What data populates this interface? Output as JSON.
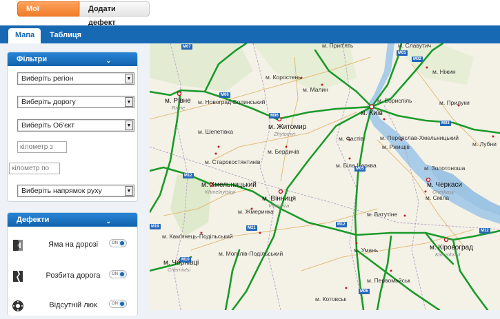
{
  "top": {
    "my_defects": "Мої дефекти",
    "add_defect": "Додати дефект"
  },
  "tabs": {
    "map": "Мапа",
    "table": "Таблиця"
  },
  "filters": {
    "title": "Фільтри",
    "region": "Виберіть регіон",
    "road": "Виберіть дорогу",
    "object": "Виберіть Об'єкт",
    "km_from_placeholder": "кілометр з",
    "km_to_placeholder": "кілометр по",
    "direction": "Виберіть напрямок руху"
  },
  "defects": {
    "title": "Дефекти",
    "items": [
      {
        "label": "Яма на дорозі",
        "icon": "pothole-icon",
        "toggle": "ON"
      },
      {
        "label": "Розбита дорога",
        "icon": "broken-road-icon",
        "toggle": "ON"
      },
      {
        "label": "Відсутній люк",
        "icon": "manhole-icon",
        "toggle": "ON"
      }
    ]
  },
  "map": {
    "cities": [
      {
        "name": "м. Рівне",
        "big": true
      },
      {
        "name": "Rivne",
        "sub": true
      },
      {
        "name": "м. Житомир",
        "big": true
      },
      {
        "name": "Zhytomyr",
        "sub": true
      },
      {
        "name": "м. Київ",
        "big": true
      },
      {
        "name": "м. Хмельницький",
        "big": true
      },
      {
        "name": "Khmelnytskyi",
        "sub": true
      },
      {
        "name": "м. Вінниця",
        "big": true
      },
      {
        "name": "Vinnytsia",
        "sub": true
      },
      {
        "name": "м. Черкаси",
        "big": true
      },
      {
        "name": "Cherkasy",
        "sub": true
      },
      {
        "name": "м. Кіровоград",
        "big": true
      },
      {
        "name": "Kirovohrad",
        "sub": true
      },
      {
        "name": "м. Чернівці",
        "big": true
      },
      {
        "name": "Chernivtsi",
        "sub": true
      },
      {
        "name": "м. Коростень"
      },
      {
        "name": "м. Малин"
      },
      {
        "name": "м. Новоград-Волинський"
      },
      {
        "name": "м. Шепетівка"
      },
      {
        "name": "м. Бердичів"
      },
      {
        "name": "м. Старокостянтинів"
      },
      {
        "name": "м. Біла Церква"
      },
      {
        "name": "м. Фастів"
      },
      {
        "name": "м. Бориспіль"
      },
      {
        "name": "м. Переяслав-Хмельницький"
      },
      {
        "name": "м. Ржищів"
      },
      {
        "name": "м. Золотоноша"
      },
      {
        "name": "м. Сміла"
      },
      {
        "name": "м. Ватутіне"
      },
      {
        "name": "м. Умань"
      },
      {
        "name": "м. Жмеринка"
      },
      {
        "name": "м. Кам'янець-Подільський"
      },
      {
        "name": "м. Могилів-Подільський"
      },
      {
        "name": "м. Первомайськ"
      },
      {
        "name": "м. Котовськ"
      },
      {
        "name": "м. Ніжин"
      },
      {
        "name": "м. Прилуки"
      },
      {
        "name": "м. Лубни"
      },
      {
        "name": "м. Прип'ять"
      },
      {
        "name": "м. Славутич"
      }
    ],
    "shields": [
      "M07",
      "M06",
      "M06",
      "M01",
      "M02",
      "M03",
      "M05",
      "M12",
      "M12",
      "M21",
      "M19",
      "M10",
      "M12",
      "M05"
    ]
  },
  "colors": {
    "accent": "#1769b3",
    "active_tab": "#f07c2a",
    "road": "#1a9a2a"
  }
}
